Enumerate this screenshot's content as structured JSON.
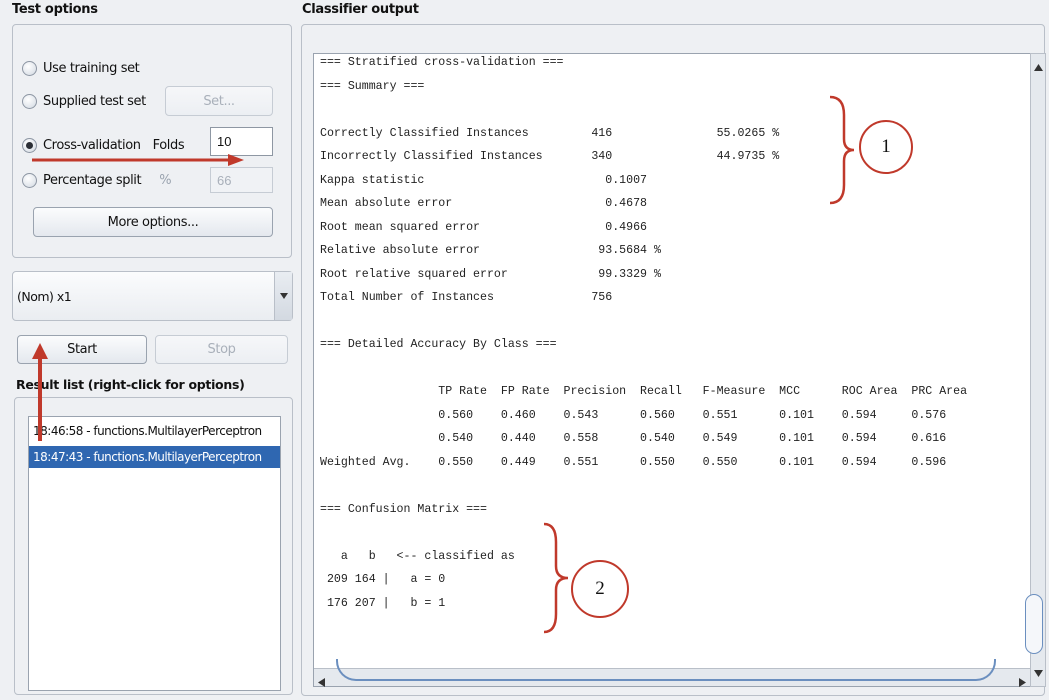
{
  "test_options": {
    "title": "Test options",
    "use_training_set": "Use training set",
    "supplied_test_set": "Supplied test set",
    "set_button": "Set...",
    "cross_validation": "Cross-validation",
    "folds_label": "Folds",
    "folds_value": "10",
    "percentage_split": "Percentage split",
    "percent_symbol": "%",
    "percentage_value": "66",
    "more_options": "More options..."
  },
  "class_select": {
    "value": "(Nom) x1"
  },
  "controls": {
    "start": "Start",
    "stop": "Stop"
  },
  "result_list": {
    "title": "Result list (right-click for options)",
    "items": [
      "18:46:58 - functions.MultilayerPerceptron",
      "18:47:43 - functions.MultilayerPerceptron"
    ],
    "selected_index": 1
  },
  "classifier_output": {
    "title": "Classifier output",
    "lines": [
      "=== Stratified cross-validation ===",
      "=== Summary ===",
      "",
      "Correctly Classified Instances         416               55.0265 %",
      "Incorrectly Classified Instances       340               44.9735 %",
      "Kappa statistic                          0.1007",
      "Mean absolute error                      0.4678",
      "Root mean squared error                  0.4966",
      "Relative absolute error                 93.5684 %",
      "Root relative squared error             99.3329 %",
      "Total Number of Instances              756",
      "",
      "=== Detailed Accuracy By Class ===",
      "",
      "                 TP Rate  FP Rate  Precision  Recall   F-Measure  MCC      ROC Area  PRC Area",
      "                 0.560    0.460    0.543      0.560    0.551      0.101    0.594     0.576",
      "                 0.540    0.440    0.558      0.540    0.549      0.101    0.594     0.616",
      "Weighted Avg.    0.550    0.449    0.551      0.550    0.550      0.101    0.594     0.596",
      "",
      "=== Confusion Matrix ===",
      "",
      "   a   b   <-- classified as",
      " 209 164 |   a = 0",
      " 176 207 |   b = 1"
    ]
  },
  "annotations": {
    "callout_1": "1",
    "callout_2": "2",
    "accent_color": "#c0392b"
  }
}
